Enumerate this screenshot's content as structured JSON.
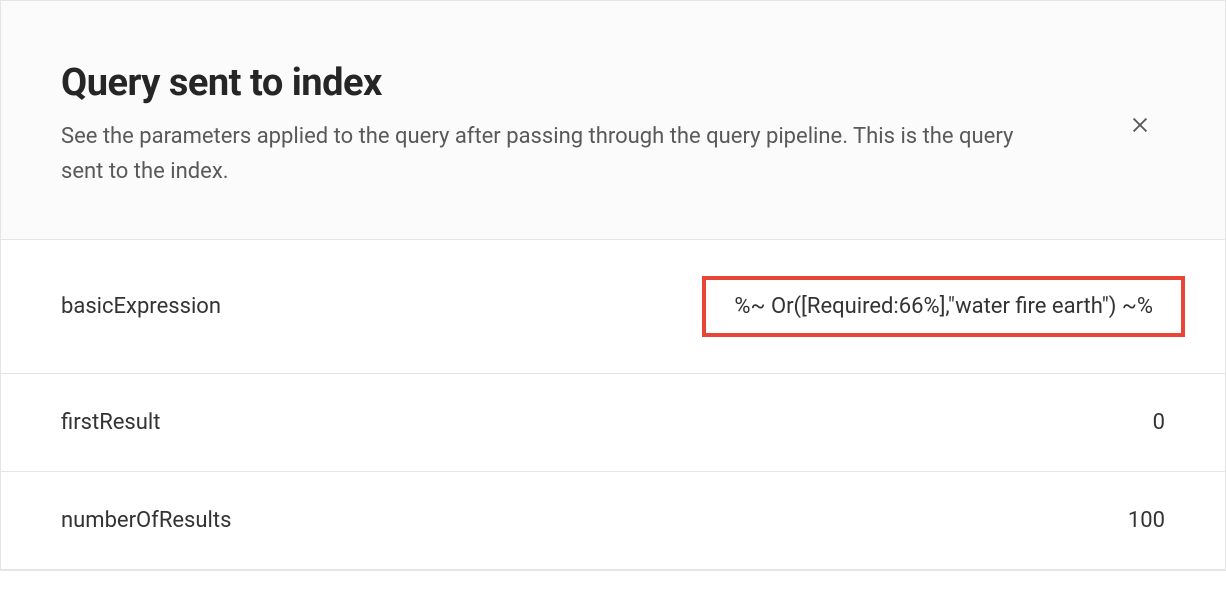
{
  "header": {
    "title": "Query sent to index",
    "description": "See the parameters applied to the query after passing through the query pipeline. This is the query sent to the index."
  },
  "rows": [
    {
      "label": "basicExpression",
      "value": "%~ Or([Required:66%],\"water fire earth\") ~%",
      "highlighted": true
    },
    {
      "label": "firstResult",
      "value": "0",
      "highlighted": false
    },
    {
      "label": "numberOfResults",
      "value": "100",
      "highlighted": false
    }
  ]
}
